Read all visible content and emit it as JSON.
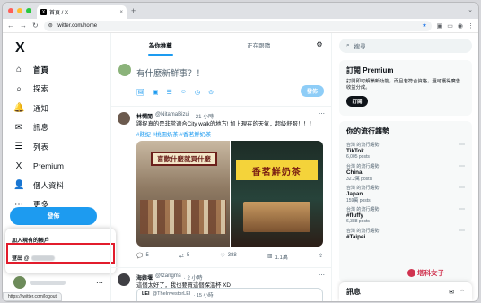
{
  "browser": {
    "tab_title": "首頁 / X",
    "tab_favicon": "X",
    "tab_close": "×",
    "new_tab": "+",
    "tabbar_right_icon": "⌄",
    "url": "twitter.com/home",
    "status_url": "https://twitter.com/logout",
    "traffic_lights": [
      "#ff5f57",
      "#febc2e",
      "#28c840"
    ]
  },
  "sidebar": {
    "logo": "X",
    "nav": [
      {
        "label": "首頁",
        "icon": "⌂",
        "active": true
      },
      {
        "label": "探索",
        "icon": "⌕"
      },
      {
        "label": "通知",
        "icon": "🔔"
      },
      {
        "label": "訊息",
        "icon": "✉"
      },
      {
        "label": "列表",
        "icon": "☰"
      },
      {
        "label": "Premium",
        "icon": "X"
      },
      {
        "label": "個人資料",
        "icon": "👤"
      },
      {
        "label": "更多",
        "icon": "⋯"
      }
    ],
    "post_button": "發佈",
    "account_menu": {
      "add_account": "加入現有的帳戶",
      "logout": "登出 @"
    },
    "more_dots": "⋯"
  },
  "main": {
    "tabs": [
      "為你推薦",
      "正在跟隨"
    ],
    "settings_icon": "⚙",
    "compose": {
      "prompt": "有什麼新鮮事？！",
      "tools": [
        "🖼",
        "▣",
        "☰",
        "☺",
        "◷",
        "⊙"
      ],
      "post_button": "發佈"
    },
    "tweets": [
      {
        "name": "林憫閒",
        "handle": "@NitamaBizui",
        "time": "· 21 小時",
        "text": "踐捉真的是非常適合City walk的地方! 加上現在的天氣，超級舒服！！！",
        "tags": "#踐捉 #桃園奶茶 #香茗鮮奶茶",
        "image_left_sign": "喜歡什麼就買什麼",
        "image_right_sign": "香茗鮮奶茶",
        "actions": [
          {
            "icon": "💬",
            "count": "5"
          },
          {
            "icon": "⇄",
            "count": "5"
          },
          {
            "icon": "♡",
            "count": "388"
          },
          {
            "icon": "▥",
            "count": "1.1萬"
          },
          {
            "icon": "⇪",
            "count": ""
          }
        ]
      },
      {
        "name": "海娘堰",
        "handle": "@tzangms",
        "time": "· 2 小時",
        "text": "這個太好了，我也要買這個保溫杯 XD",
        "quote_author": "LEI",
        "quote_handle": "@TheInvestorLEI",
        "quote_time": "· 15 小時"
      }
    ]
  },
  "right": {
    "search_placeholder": "搜尋",
    "premium": {
      "title": "訂閱 Premium",
      "body": "訂閱即可解鎖新功能，而且若符合資格，還可獲得廣告收益分成。",
      "button": "訂閱"
    },
    "trends_title": "你的流行趨勢",
    "trends": [
      {
        "context": "台灣 的流行趨勢",
        "name": "TikTok",
        "posts": "6,005 posts"
      },
      {
        "context": "台灣 的流行趨勢",
        "name": "China",
        "posts": "32.2萬 posts"
      },
      {
        "context": "台灣 的流行趨勢",
        "name": "Japan",
        "posts": "159萬 posts"
      },
      {
        "context": "台灣 的流行趨勢",
        "name": "#fluffy",
        "posts": "6,388 posts"
      },
      {
        "context": "台灣 的流行趨勢",
        "name": "#Taipei",
        "posts": ""
      }
    ],
    "messages_title": "訊息",
    "watermark": "塔科女子"
  },
  "colors": {
    "accent": "#1d9bf0",
    "highlight_box": "#e21c2c"
  }
}
